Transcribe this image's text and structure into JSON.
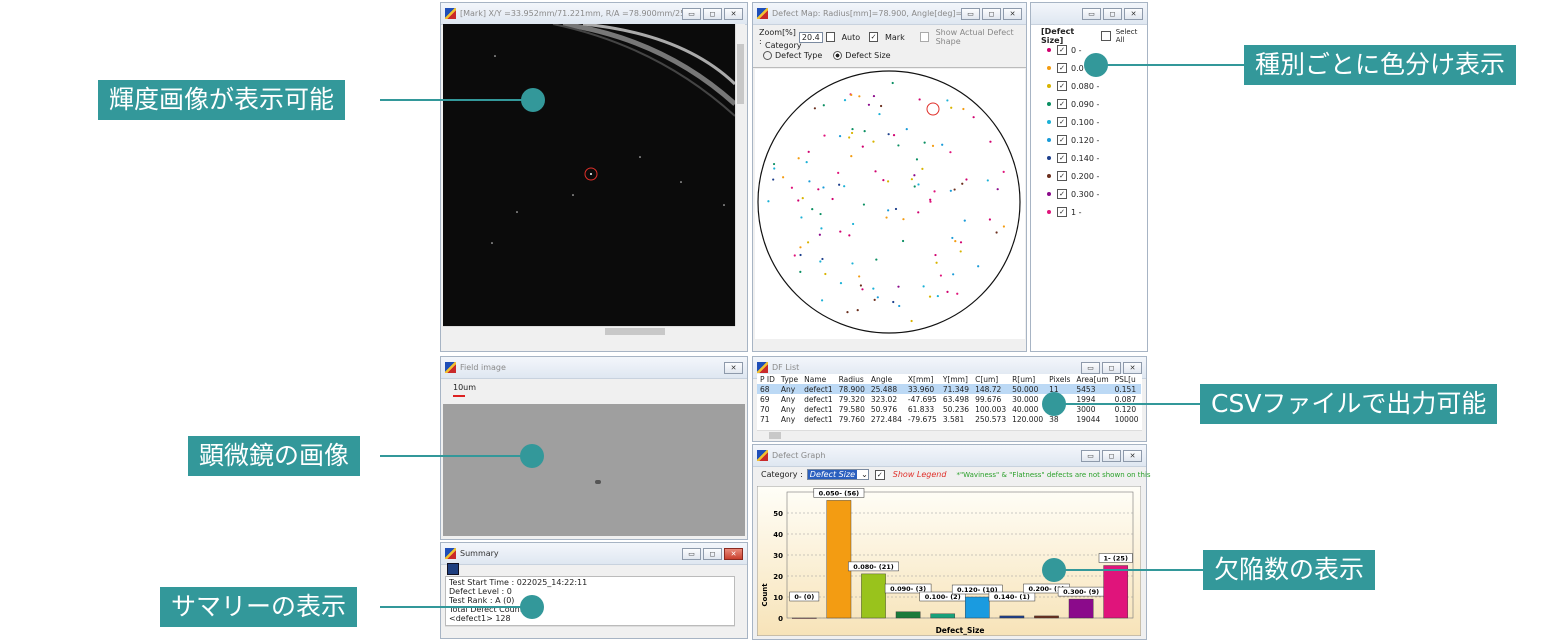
{
  "windows": {
    "mark": {
      "title": "[Mark] X/Y =33.952mm/71.221mm, R/A =78.900mm/25.488deg"
    },
    "defect_map": {
      "title": "Defect Map: Radius[mm]=78.900, Angle[deg]=25.488",
      "zoom_label": "Zoom[%] :",
      "zoom_value": "20.4",
      "auto_label": "Auto",
      "mark_label": "Mark",
      "show_shape_label": "Show Actual Defect Shape",
      "category_label": "Category",
      "radio_type": "Defect Type",
      "radio_size": "Defect Size"
    },
    "legend": {
      "heading": "[Defect Size]",
      "select_all": "Select All",
      "items": [
        {
          "label": "0 -",
          "color": "#d0006f"
        },
        {
          "label": "0.0",
          "color": "#f39c12"
        },
        {
          "label": "0.080 -",
          "color": "#d8b400"
        },
        {
          "label": "0.090 -",
          "color": "#0a8f62"
        },
        {
          "label": "0.100 -",
          "color": "#1bb1d6"
        },
        {
          "label": "0.120 -",
          "color": "#1a9bd8"
        },
        {
          "label": "0.140 -",
          "color": "#1d3f8c"
        },
        {
          "label": "0.200 -",
          "color": "#6b2f1e"
        },
        {
          "label": "0.300 -",
          "color": "#8b0a8b"
        },
        {
          "label": "1 -",
          "color": "#e0147b"
        }
      ]
    },
    "field_image": {
      "title": "Field image",
      "scale_label": "10um"
    },
    "df_list": {
      "title": "DF List",
      "columns": [
        "P ID",
        "Type",
        "Name",
        "Radius",
        "Angle",
        "X[mm]",
        "Y[mm]",
        "C[um]",
        "R[um]",
        "Pixels",
        "Area[um",
        "PSL[u"
      ],
      "rows": [
        [
          "68",
          "Any",
          "defect1",
          "78.900",
          "25.488",
          "33.960",
          "71.349",
          "148.72",
          "50.000",
          "11",
          "5453",
          "0.151"
        ],
        [
          "69",
          "Any",
          "defect1",
          "79.320",
          "323.02",
          "-47.695",
          "63.498",
          "99.676",
          "30.000",
          "",
          "1994",
          "0.087"
        ],
        [
          "70",
          "Any",
          "defect1",
          "79.580",
          "50.976",
          "61.833",
          "50.236",
          "100.003",
          "40.000",
          "",
          "3000",
          "0.120"
        ],
        [
          "71",
          "Any",
          "defect1",
          "79.760",
          "272.484",
          "-79.675",
          "3.581",
          "250.573",
          "120.000",
          "38",
          "19044",
          "10000"
        ]
      ]
    },
    "defect_graph": {
      "title": "Defect Graph",
      "category_label": "Category :",
      "category_value": "Defect Size",
      "show_legend": "Show Legend",
      "note": "*\"Waviness\" & \"Flatness\" defects are not shown on this"
    },
    "summary": {
      "title": "Summary",
      "lines": [
        "Test Start Time : 022025_14:22:11",
        "Defect Level : 0",
        "Test Rank : A (0)",
        "Total Defect Count :",
        "<defect1> 128"
      ]
    }
  },
  "callouts": {
    "brightness": "輝度画像が表示可能",
    "microscope": "顕微鏡の画像",
    "summary": "サマリーの表示",
    "color_coding": "種別ごとに色分け表示",
    "csv": "CSVファイルで出力可能",
    "defect_count": "欠陥数の表示"
  },
  "colors": {
    "accent": "#33989a"
  },
  "chart_data": {
    "type": "bar",
    "xlabel": "Defect_Size",
    "ylabel": "Count",
    "ylim": [
      0,
      60
    ],
    "yticks": [
      0,
      10,
      20,
      30,
      40,
      50
    ],
    "categories": [
      "0-",
      "0.050-",
      "0.080-",
      "0.090-",
      "0.100-",
      "0.120-",
      "0.140-",
      "0.200-",
      "0.300-",
      "1-"
    ],
    "values": [
      0,
      56,
      21,
      3,
      2,
      10,
      1,
      1,
      9,
      25
    ],
    "data_labels": [
      "0- (0)",
      "0.050- (56)",
      "0.080- (21)",
      "0.090- (3)",
      "0.100- (2)",
      "0.120- (10)",
      "0.140- (1)",
      "0.200- (1)",
      "0.300- (9)",
      "1- (25)"
    ],
    "colors": [
      "#d0006f",
      "#f39c12",
      "#99c31c",
      "#1a7a3a",
      "#18a07a",
      "#1a9be0",
      "#1d3f8c",
      "#6b2f1e",
      "#8b0a8b",
      "#e0147b"
    ]
  }
}
